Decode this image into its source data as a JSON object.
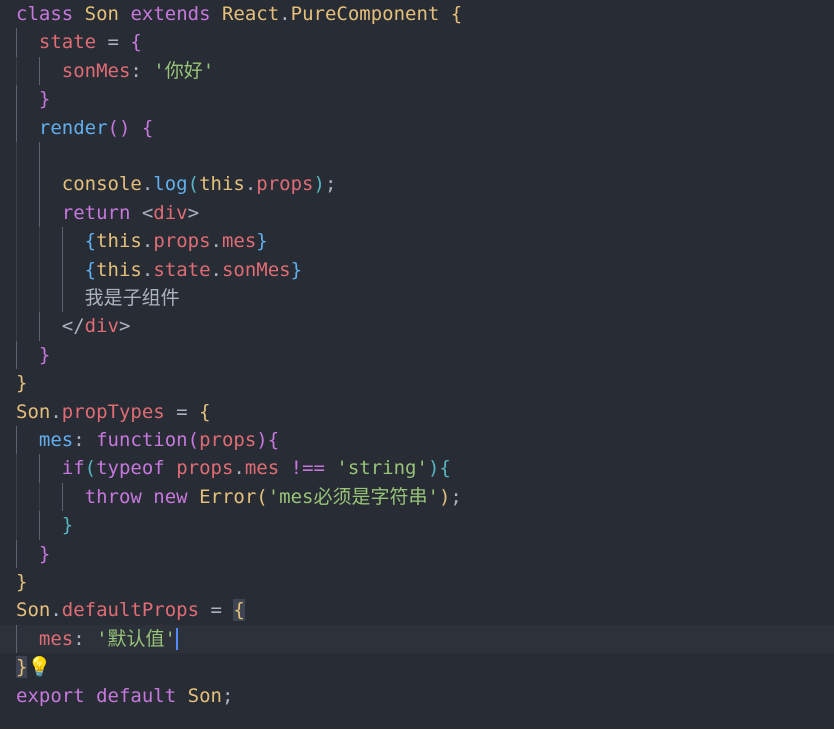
{
  "editor": {
    "theme_colors": {
      "background": "#282c34",
      "keyword": "#c678dd",
      "class": "#e5c07b",
      "property": "#e06c75",
      "function": "#61afef",
      "string": "#98c379",
      "punctuation": "#abb2bf",
      "cyan": "#56b6c2",
      "caret": "#528bff"
    },
    "code_lines": [
      [
        [
          "kw",
          "class"
        ],
        [
          "pun",
          " "
        ],
        [
          "cls",
          "Son"
        ],
        [
          "pun",
          " "
        ],
        [
          "kw",
          "extends"
        ],
        [
          "pun",
          " "
        ],
        [
          "cls",
          "React"
        ],
        [
          "pun",
          "."
        ],
        [
          "cls",
          "PureComponent"
        ],
        [
          "pun",
          " "
        ],
        [
          "br1",
          "{"
        ]
      ],
      [
        [
          "pun",
          "  "
        ],
        [
          "prop",
          "state"
        ],
        [
          "pun",
          " = "
        ],
        [
          "br2",
          "{"
        ]
      ],
      [
        [
          "pun",
          "    "
        ],
        [
          "prop",
          "sonMes"
        ],
        [
          "pun",
          ": "
        ],
        [
          "str",
          "'你好'"
        ]
      ],
      [
        [
          "pun",
          "  "
        ],
        [
          "br2",
          "}"
        ]
      ],
      [
        [
          "pun",
          "  "
        ],
        [
          "fn",
          "render"
        ],
        [
          "br2",
          "()"
        ],
        [
          "pun",
          " "
        ],
        [
          "br2",
          "{"
        ]
      ],
      [],
      [
        [
          "pun",
          "    "
        ],
        [
          "cls",
          "console"
        ],
        [
          "pun",
          "."
        ],
        [
          "fn",
          "log"
        ],
        [
          "br3",
          "("
        ],
        [
          "cls",
          "this"
        ],
        [
          "pun",
          "."
        ],
        [
          "prop",
          "props"
        ],
        [
          "br3",
          ")"
        ],
        [
          "pun",
          ";"
        ]
      ],
      [
        [
          "pun",
          "    "
        ],
        [
          "kw",
          "return"
        ],
        [
          "pun",
          " <"
        ],
        [
          "prop",
          "div"
        ],
        [
          "pun",
          ">"
        ]
      ],
      [
        [
          "pun",
          "      "
        ],
        [
          "fn",
          "{"
        ],
        [
          "cls",
          "this"
        ],
        [
          "pun",
          "."
        ],
        [
          "prop",
          "props"
        ],
        [
          "pun",
          "."
        ],
        [
          "prop",
          "mes"
        ],
        [
          "fn",
          "}"
        ]
      ],
      [
        [
          "pun",
          "      "
        ],
        [
          "fn",
          "{"
        ],
        [
          "cls",
          "this"
        ],
        [
          "pun",
          "."
        ],
        [
          "prop",
          "state"
        ],
        [
          "pun",
          "."
        ],
        [
          "prop",
          "sonMes"
        ],
        [
          "fn",
          "}"
        ]
      ],
      [
        [
          "pun",
          "      "
        ],
        [
          "txt",
          "我是子组件"
        ]
      ],
      [
        [
          "pun",
          "    </"
        ],
        [
          "prop",
          "div"
        ],
        [
          "pun",
          ">"
        ]
      ],
      [
        [
          "pun",
          "  "
        ],
        [
          "br2",
          "}"
        ]
      ],
      [
        [
          "br1",
          "}"
        ]
      ],
      [
        [
          "cls",
          "Son"
        ],
        [
          "pun",
          "."
        ],
        [
          "prop",
          "propTypes"
        ],
        [
          "pun",
          " = "
        ],
        [
          "br1",
          "{"
        ]
      ],
      [
        [
          "pun",
          "  "
        ],
        [
          "fn",
          "mes"
        ],
        [
          "pun",
          ": "
        ],
        [
          "kw",
          "function"
        ],
        [
          "br2",
          "("
        ],
        [
          "prop",
          "props"
        ],
        [
          "br2",
          ")"
        ],
        [
          "br2",
          "{"
        ]
      ],
      [
        [
          "pun",
          "    "
        ],
        [
          "kw",
          "if"
        ],
        [
          "br3",
          "("
        ],
        [
          "kw",
          "typeof"
        ],
        [
          "pun",
          " "
        ],
        [
          "prop",
          "props"
        ],
        [
          "pun",
          "."
        ],
        [
          "prop",
          "mes"
        ],
        [
          "pun",
          " "
        ],
        [
          "kw",
          "!=="
        ],
        [
          "pun",
          " "
        ],
        [
          "str",
          "'string'"
        ],
        [
          "br3",
          ")"
        ],
        [
          "br3",
          "{"
        ]
      ],
      [
        [
          "pun",
          "      "
        ],
        [
          "kw",
          "throw"
        ],
        [
          "pun",
          " "
        ],
        [
          "kw",
          "new"
        ],
        [
          "pun",
          " "
        ],
        [
          "cls",
          "Error"
        ],
        [
          "br1",
          "("
        ],
        [
          "str",
          "'mes必须是字符串'"
        ],
        [
          "br1",
          ")"
        ],
        [
          "pun",
          ";"
        ]
      ],
      [
        [
          "pun",
          "    "
        ],
        [
          "br3",
          "}"
        ]
      ],
      [
        [
          "pun",
          "  "
        ],
        [
          "br2",
          "}"
        ]
      ],
      [
        [
          "br1",
          "}"
        ]
      ],
      [
        [
          "cls",
          "Son"
        ],
        [
          "pun",
          "."
        ],
        [
          "prop",
          "defaultProps"
        ],
        [
          "pun",
          " = "
        ],
        [
          "br1",
          "{"
        ]
      ],
      [
        [
          "pun",
          "  "
        ],
        [
          "prop",
          "mes"
        ],
        [
          "pun",
          ": "
        ],
        [
          "str",
          "'默认值'"
        ]
      ],
      [
        [
          "br1",
          "}"
        ],
        [
          "bulb",
          "💡"
        ]
      ],
      [
        [
          "kw",
          "export"
        ],
        [
          "pun",
          " "
        ],
        [
          "kw",
          "default"
        ],
        [
          "pun",
          " "
        ],
        [
          "cls",
          "Son"
        ],
        [
          "pun",
          ";"
        ]
      ]
    ],
    "current_line_index": 22,
    "lightbulb_icon": "lightbulb-icon"
  }
}
